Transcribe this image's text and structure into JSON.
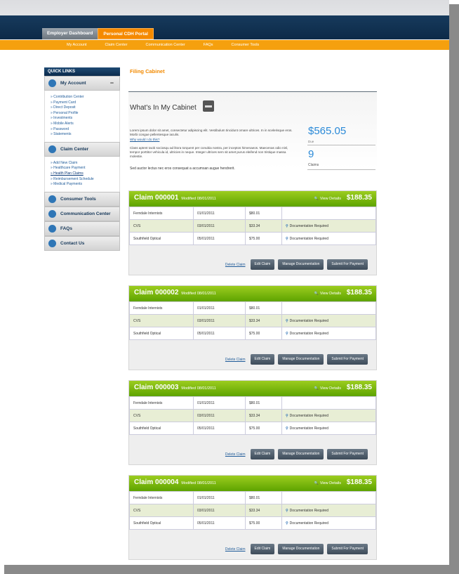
{
  "nav": {
    "tabs": [
      "Employer Dashboard",
      "Personal CDH Portal"
    ],
    "subnav": [
      "My Account",
      "Claim Center",
      "Communication Center",
      "FAQs",
      "Consumer Tools"
    ]
  },
  "sidebar": {
    "quick_links_title": "QUICK LINKS",
    "my_account": {
      "label": "My Account",
      "links": [
        "Contribution Center",
        "Payment Card",
        "Direct Deposit",
        "Personal Profile",
        "Investments",
        "Mobile Alerts",
        "Password",
        "Statements"
      ]
    },
    "claim_center": {
      "label": "Claim Center",
      "links": [
        "Add New Claim",
        "Healthcare Payment",
        "Health Plan Claims",
        "Reimbursement Schedule",
        "Medical Payments"
      ]
    },
    "sections": [
      "Consumer Tools",
      "Communication Center",
      "FAQs",
      "Contact Us"
    ]
  },
  "main": {
    "breadcrumb": "Filing Cabinet",
    "cabinet_title": "What's In My Cabinet",
    "lorem1": "Lorem ipsum dolor sit amet, consectetur adipiscing elit. Vestibulum tincidunt ornare ultrices. In in scelerisque eros. Morbi congue pellentesque iaculis.",
    "why_link": "Why would I do this?",
    "lorem2": "Class aptent taciti sociosqu ad litora torquent per conubia nostra, per inceptos himenaeos. Maecenas odio nisl, tempor porttitor vehicula id, ultricies in neque. Integer ultrices sem sit amet purus eleifend non tristique massa molestie.",
    "sed_text": "Sed auctor lectus nec eros consequat a accumsan augue hendrerit.",
    "amount": "$565.05",
    "amount_label": "Due",
    "claims_count": "9",
    "claims_label": "Claims"
  },
  "claims": [
    {
      "title": "Claim 000001",
      "modified": "Modified 08/01/2011",
      "view_details": "View Details",
      "amount": "$188.35",
      "rows": [
        [
          "Ferndale Internists",
          "01/01/2011",
          "$80.01",
          ""
        ],
        [
          "CVS",
          "03/01/2011",
          "$33.34",
          "Documentation Required"
        ],
        [
          "Southfield Optical",
          "05/01/2011",
          "$75.00",
          "Documentation Required"
        ]
      ],
      "delete": "Delete Claim",
      "edit": "Edit Claim",
      "manage": "Manage Documentation",
      "submit": "Submit For Payment"
    },
    {
      "title": "Claim 000002",
      "modified": "Modified 08/01/2011",
      "view_details": "View Details",
      "amount": "$188.35",
      "rows": [
        [
          "Ferndale Internists",
          "01/01/2011",
          "$80.01",
          ""
        ],
        [
          "CVS",
          "03/01/2011",
          "$33.34",
          "Documentation Required"
        ],
        [
          "Southfield Optical",
          "05/01/2011",
          "$75.00",
          "Documentation Required"
        ]
      ],
      "delete": "Delete Claim",
      "edit": "Edit Claim",
      "manage": "Manage Documentation",
      "submit": "Submit For Payment"
    },
    {
      "title": "Claim 000003",
      "modified": "Modified 08/01/2011",
      "view_details": "View Details",
      "amount": "$188.35",
      "rows": [
        [
          "Ferndale Internists",
          "01/01/2011",
          "$80.01",
          ""
        ],
        [
          "CVS",
          "03/01/2011",
          "$33.34",
          "Documentation Required"
        ],
        [
          "Southfield Optical",
          "05/01/2011",
          "$75.00",
          "Documentation Required"
        ]
      ],
      "delete": "Delete Claim",
      "edit": "Edit Claim",
      "manage": "Manage Documentation",
      "submit": "Submit For Payment"
    },
    {
      "title": "Claim 000004",
      "modified": "Modified 08/01/2011",
      "view_details": "View Details",
      "amount": "$188.35",
      "rows": [
        [
          "Ferndale Internists",
          "01/01/2011",
          "$80.01",
          ""
        ],
        [
          "CVS",
          "03/01/2011",
          "$33.34",
          "Documentation Required"
        ],
        [
          "Southfield Optical",
          "05/01/2011",
          "$75.00",
          "Documentation Required"
        ]
      ],
      "delete": "Delete Claim",
      "edit": "Edit Claim",
      "manage": "Manage Documentation",
      "submit": "Submit For Payment"
    }
  ]
}
